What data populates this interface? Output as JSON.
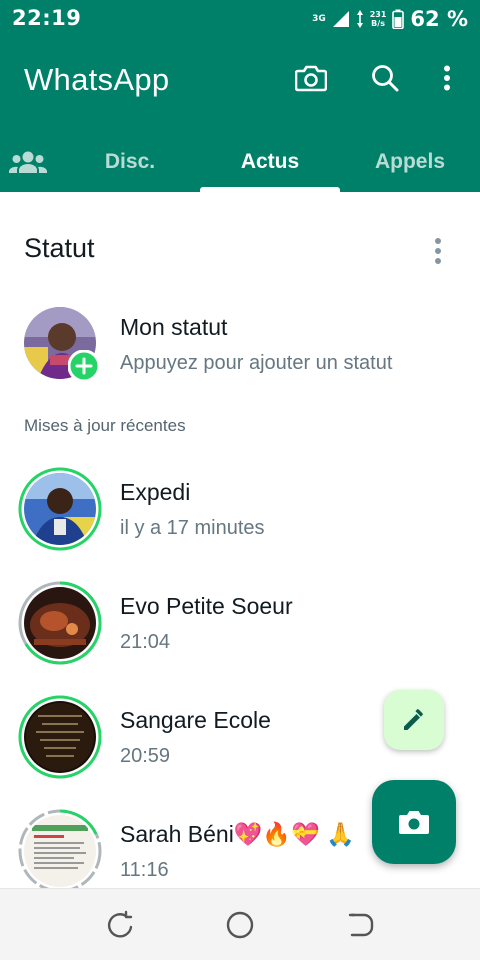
{
  "status_bar": {
    "time": "22:19",
    "network": "3G",
    "speed_value": "231",
    "speed_unit": "B/s",
    "battery_pct": "62 %"
  },
  "header": {
    "title": "WhatsApp",
    "camera_icon": "camera-icon",
    "search_icon": "search-icon",
    "menu_icon": "more-vert-icon"
  },
  "tabs": [
    {
      "label": "",
      "icon": "community-icon"
    },
    {
      "label": "Disc."
    },
    {
      "label": "Actus",
      "active": true
    },
    {
      "label": "Appels"
    }
  ],
  "status_section": {
    "title": "Statut",
    "my_status": {
      "name": "Mon statut",
      "subtitle": "Appuyez pour ajouter un statut"
    },
    "recent_label": "Mises à jour récentes",
    "updates": [
      {
        "name": "Expedi",
        "time": "il y a 17 minutes"
      },
      {
        "name": "Evo Petite Soeur",
        "time": "21:04"
      },
      {
        "name": "Sangare Ecole",
        "time": "20:59"
      },
      {
        "name": "Sarah Béni💖🔥💝 🙏",
        "time": "11:16"
      }
    ]
  },
  "fabs": {
    "edit_icon": "pencil-icon",
    "camera_icon": "camera-icon"
  },
  "colors": {
    "brand": "#008069",
    "ring_unseen": "#25d366",
    "ring_seen": "#b0b7bb",
    "fab_light": "#d9fdd3"
  }
}
